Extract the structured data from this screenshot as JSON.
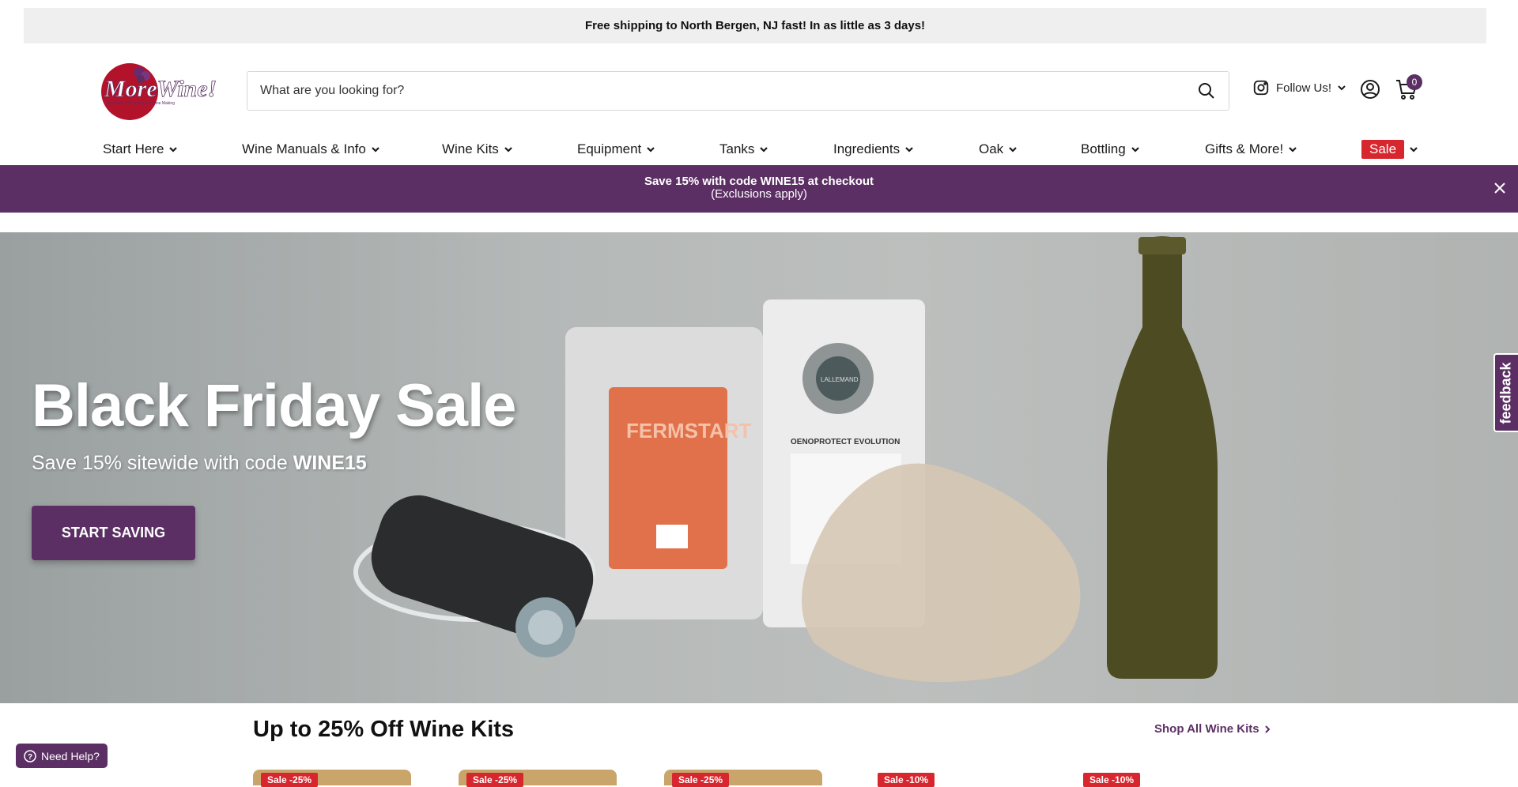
{
  "topbar": {
    "text": "Free shipping to North Bergen, NJ fast! In as little as 3 days!"
  },
  "header": {
    "logo_text": "MoreWine!",
    "logo_tagline": "Absolutely Everything! for Wine Making",
    "search_placeholder": "What are you looking for?",
    "follow_label": "Follow Us!",
    "cart_count": "0"
  },
  "nav": {
    "items": [
      {
        "label": "Start Here"
      },
      {
        "label": "Wine Manuals & Info"
      },
      {
        "label": "Wine Kits"
      },
      {
        "label": "Equipment"
      },
      {
        "label": "Tanks"
      },
      {
        "label": "Ingredients"
      },
      {
        "label": "Oak"
      },
      {
        "label": "Bottling"
      },
      {
        "label": "Gifts & More!"
      },
      {
        "label": "Sale"
      }
    ]
  },
  "promo": {
    "line1": "Save 15% with code WINE15 at checkout",
    "line2": "(Exclusions apply)"
  },
  "hero": {
    "title": "Black Friday Sale",
    "subtitle_prefix": "Save 15% sitewide with code ",
    "subtitle_code": "WINE15",
    "button_label": "START SAVING",
    "yeast_pack_label": "FERMSTART",
    "yeast_pack2_label": "LALLEMAND",
    "yeast_pack2_sub": "OENOPROTECT EVOLUTION"
  },
  "feedback_label": "feedback",
  "section": {
    "title": "Up to 25% Off Wine Kits",
    "shop_all": "Shop All Wine Kits"
  },
  "products": [
    {
      "badge": "Sale -25%"
    },
    {
      "badge": "Sale -25%"
    },
    {
      "badge": "Sale -25%"
    },
    {
      "badge": "Sale -10%"
    },
    {
      "badge": "Sale -10%"
    }
  ],
  "help_label": "Need Help?",
  "colors": {
    "brand_purple": "#5c2f64",
    "sale_red": "#d7262e",
    "topbar_gray": "#efefef"
  }
}
